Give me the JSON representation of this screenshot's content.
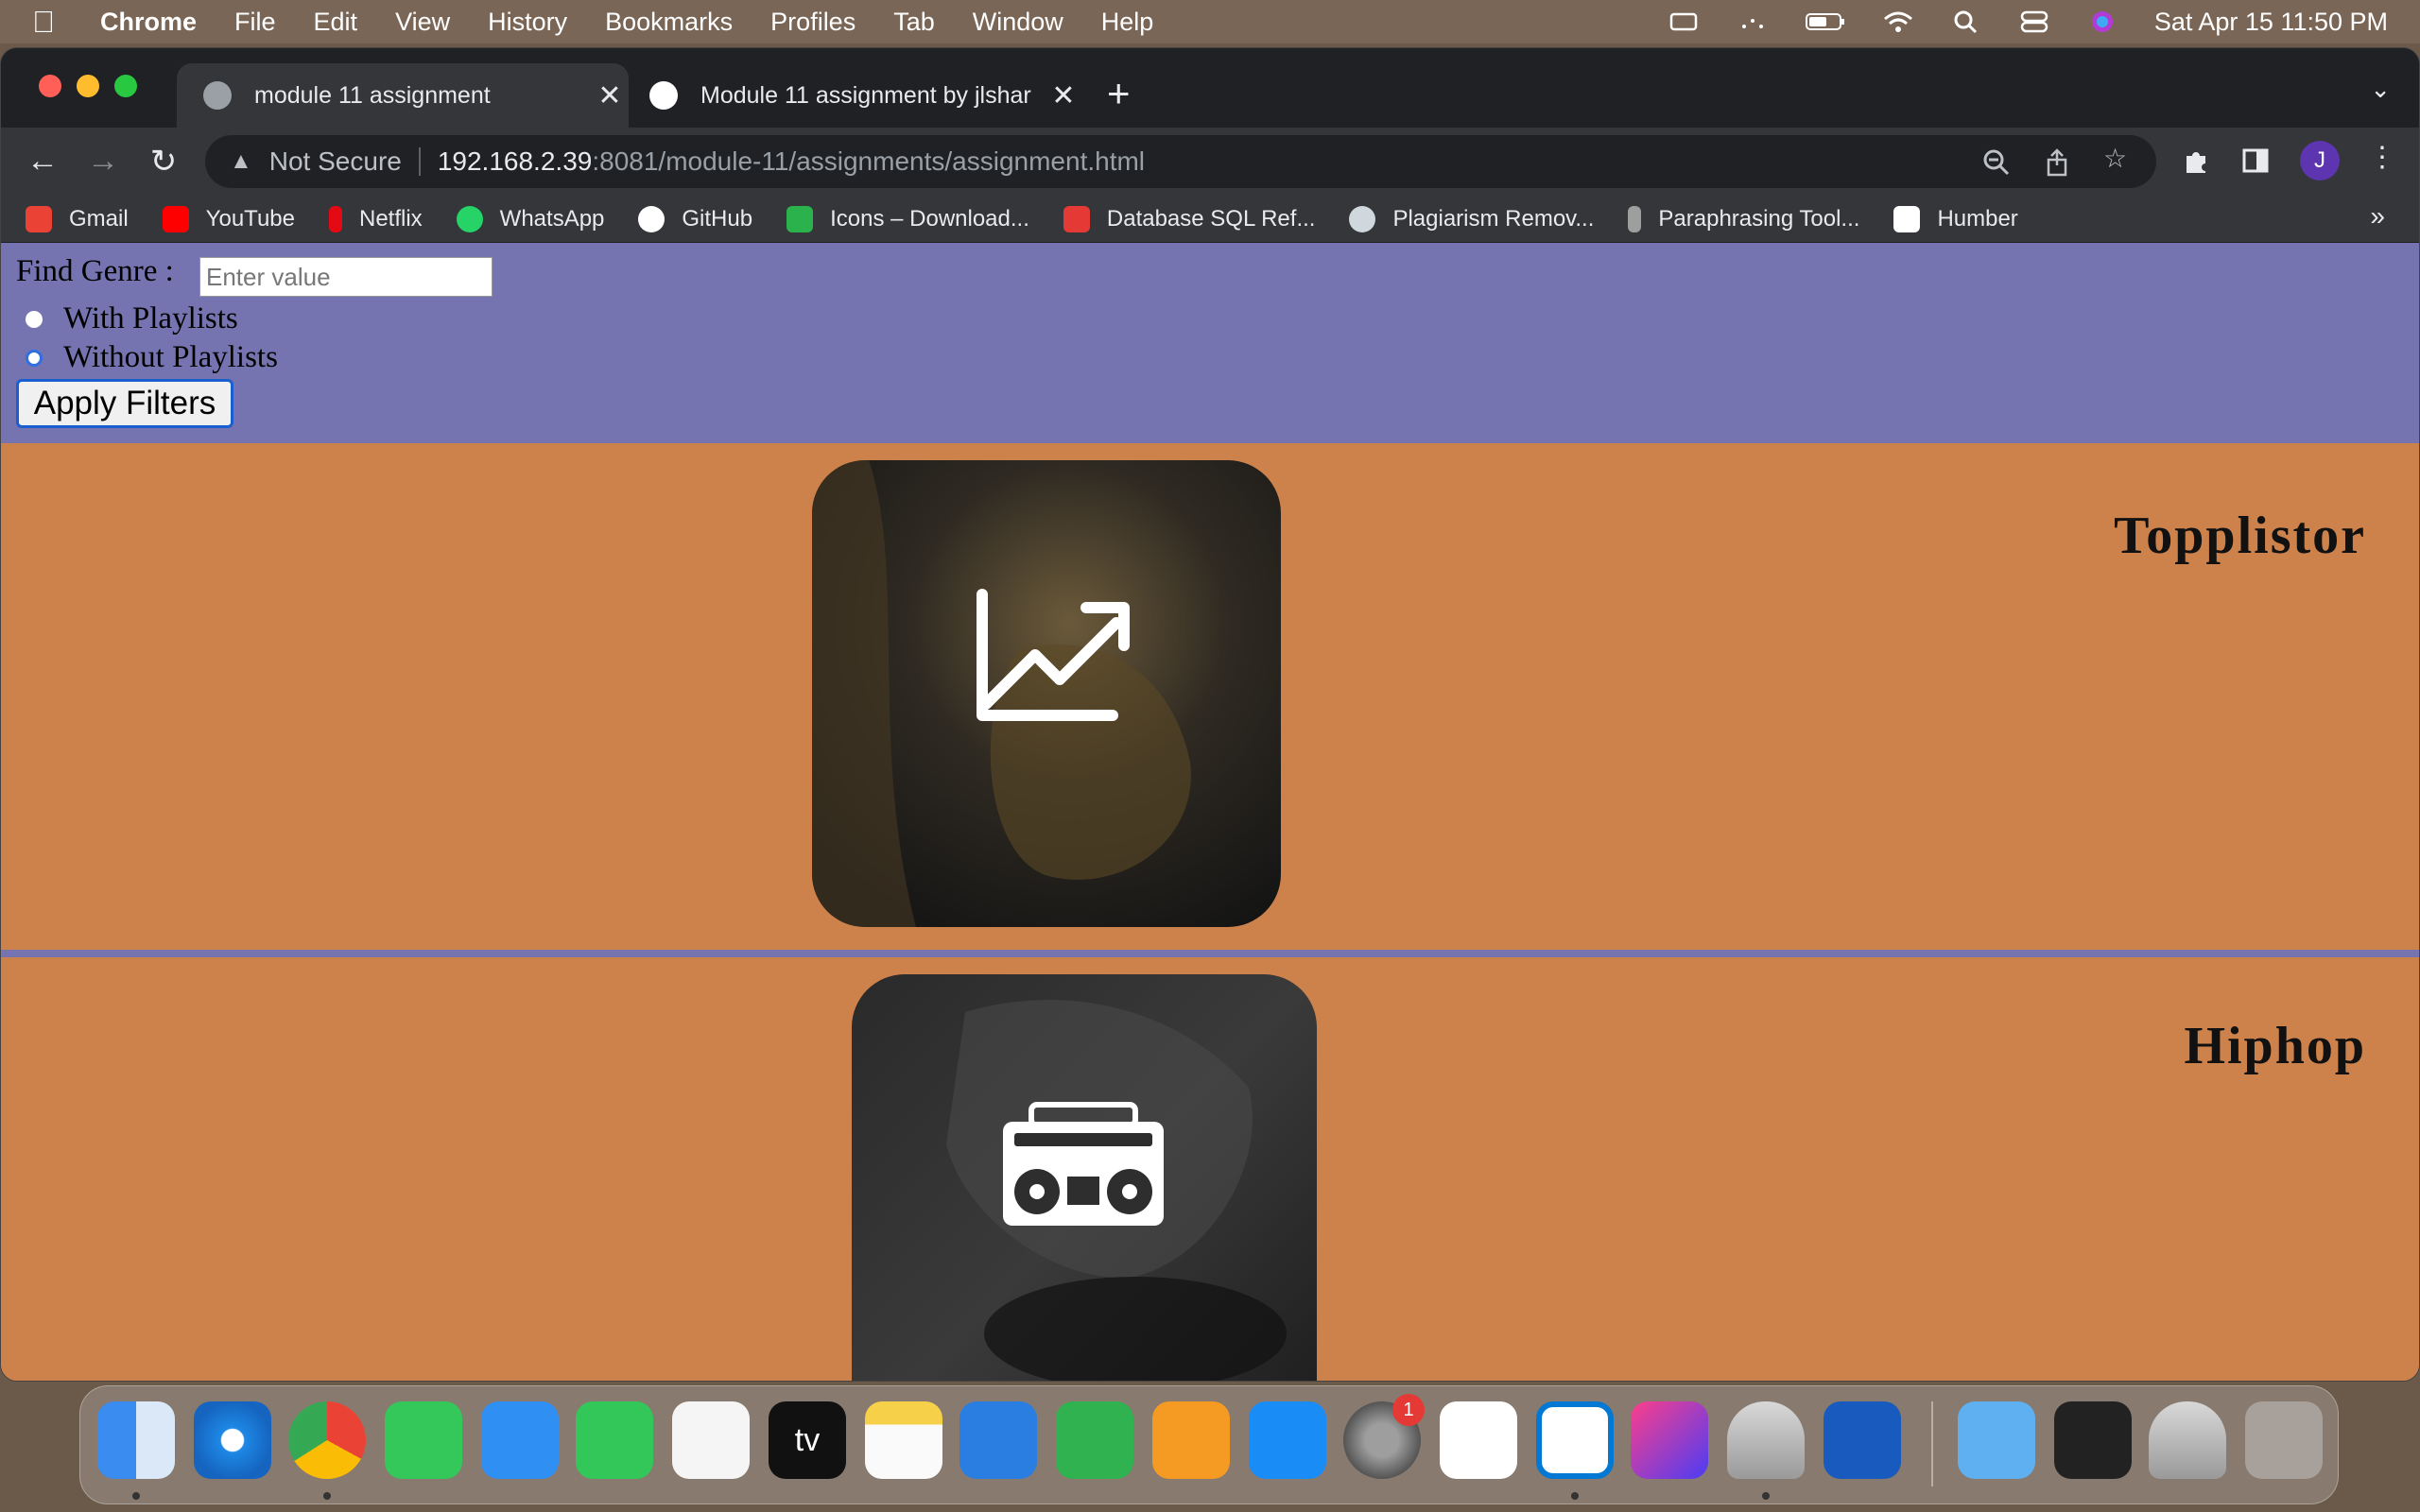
{
  "menubar": {
    "app_name": "Chrome",
    "items": [
      "File",
      "Edit",
      "View",
      "History",
      "Bookmarks",
      "Profiles",
      "Tab",
      "Window",
      "Help"
    ],
    "clock": "Sat Apr 15  11:50 PM"
  },
  "tabs": [
    {
      "title": "module 11 assignment",
      "active": true
    },
    {
      "title": "Module 11 assignment by jlshar",
      "active": false
    }
  ],
  "address_bar": {
    "security_label": "Not Secure",
    "host": "192.168.2.39",
    "path": ":8081/module-11/assignments/assignment.html"
  },
  "profile_initial": "J",
  "bookmarks": [
    {
      "label": "Gmail",
      "color": "#ea4335"
    },
    {
      "label": "YouTube",
      "color": "#ff0000"
    },
    {
      "label": "Netflix",
      "color": "#e50914"
    },
    {
      "label": "WhatsApp",
      "color": "#25d366"
    },
    {
      "label": "GitHub",
      "color": "#ffffff"
    },
    {
      "label": "Icons – Download...",
      "color": "#2bb24c"
    },
    {
      "label": "Database SQL Ref...",
      "color": "#e53935"
    },
    {
      "label": "Plagiarism Remov...",
      "color": "#cfd8dc"
    },
    {
      "label": "Paraphrasing Tool...",
      "color": "#9e9e9e"
    },
    {
      "label": "Humber",
      "color": "#ffffff"
    }
  ],
  "filters": {
    "find_label": "Find Genre :",
    "input_placeholder": "Enter value",
    "option_with": "With Playlists",
    "option_without": "Without Playlists",
    "apply_label": "Apply Filters"
  },
  "genres": [
    {
      "name": "Topplistor",
      "icon": "trending-chart-icon"
    },
    {
      "name": "Hiphop",
      "icon": "boombox-icon"
    }
  ],
  "dock": {
    "apps": [
      "Finder",
      "Safari",
      "Chrome",
      "Messages",
      "Mail",
      "FaceTime",
      "Reminders",
      "Apple TV",
      "Notes",
      "Keynote",
      "Numbers",
      "Pages",
      "App Store",
      "System Settings",
      "Tableau",
      "VS Code",
      "IntelliJ IDEA",
      "Database",
      "Word"
    ],
    "settings_badge": "1",
    "tv_label": "tv"
  },
  "colors": {
    "page_background": "#cd824c",
    "filter_panel": "#7574b0",
    "divider": "#7574b0"
  }
}
